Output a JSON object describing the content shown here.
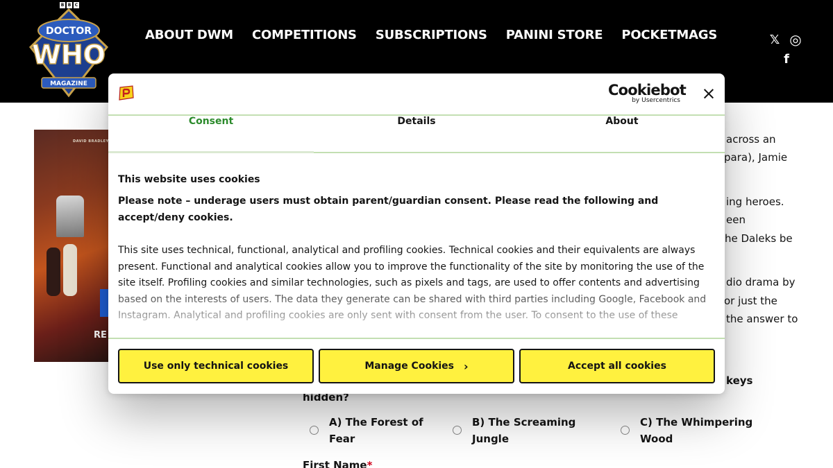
{
  "header": {
    "bbc_letters": [
      "B",
      "B",
      "C"
    ],
    "logo_words": {
      "top": "DOCTOR",
      "main": "WHO",
      "bottom": "MAGAZINE"
    },
    "nav": [
      {
        "label": "ABOUT DWM"
      },
      {
        "label": "COMPETITIONS"
      },
      {
        "label": "SUBSCRIPTIONS"
      },
      {
        "label": "PANINI STORE"
      },
      {
        "label": "POCKETMAGS"
      }
    ],
    "social": [
      {
        "icon": "x-icon",
        "glyph": "𝕏"
      },
      {
        "icon": "instagram-icon",
        "glyph": "◎"
      },
      {
        "icon": "facebook-icon",
        "glyph": "f"
      }
    ]
  },
  "article": {
    "cover_author": "DAVID BRADLEY",
    "cover_title_fragment": "RE",
    "right_lines": [
      "across an",
      "para), Jamie",
      "ing heroes.",
      "een",
      "he Daleks be",
      "dio drama by",
      "or just the",
      "the answer to"
    ],
    "question_line1_fragment": "keys",
    "question_line2": "hidden?",
    "options": [
      {
        "line1": "A) The Forest of",
        "line2": "Fear"
      },
      {
        "line1": "B) The Screaming",
        "line2": "Jungle"
      },
      {
        "line1": "C) The Whimpering",
        "line2": "Wood"
      }
    ],
    "first_name_label": "First Name",
    "required_mark": "*"
  },
  "cookie_dialog": {
    "brand_word": "Cookiebot",
    "brand_sub": "by Usercentrics",
    "close_glyph": "×",
    "tabs": [
      {
        "label": "Consent",
        "active": true
      },
      {
        "label": "Details",
        "active": false
      },
      {
        "label": "About",
        "active": false
      }
    ],
    "heading": "This website uses cookies",
    "notice": "Please note – underage users must obtain parent/guardian consent. Please read the following and accept/deny cookies.",
    "body": "This site uses technical, functional, analytical and profiling cookies. Technical cookies and their equivalents are always present.  Functional and analytical cookies allow you to improve the functionality of the site by monitoring the use of the site itself.  Profiling cookies and similar technologies, such as pixels and tags, are used to offer contents and advertising based on the interests of users.  The data they generate can be shared with third parties including Google, Facebook and Instagram. Analytical and profiling cookies are only sent with consent from the user.  To consent to the use of these",
    "buttons": {
      "technical": "Use only technical cookies",
      "manage": "Manage Cookies",
      "manage_chevron": "›",
      "accept": "Accept all cookies"
    }
  },
  "colors": {
    "header_bg": "#000000",
    "accent_green": "#2b8a2b",
    "divider_green": "#c3dfb2",
    "button_yellow": "#fff13f"
  }
}
